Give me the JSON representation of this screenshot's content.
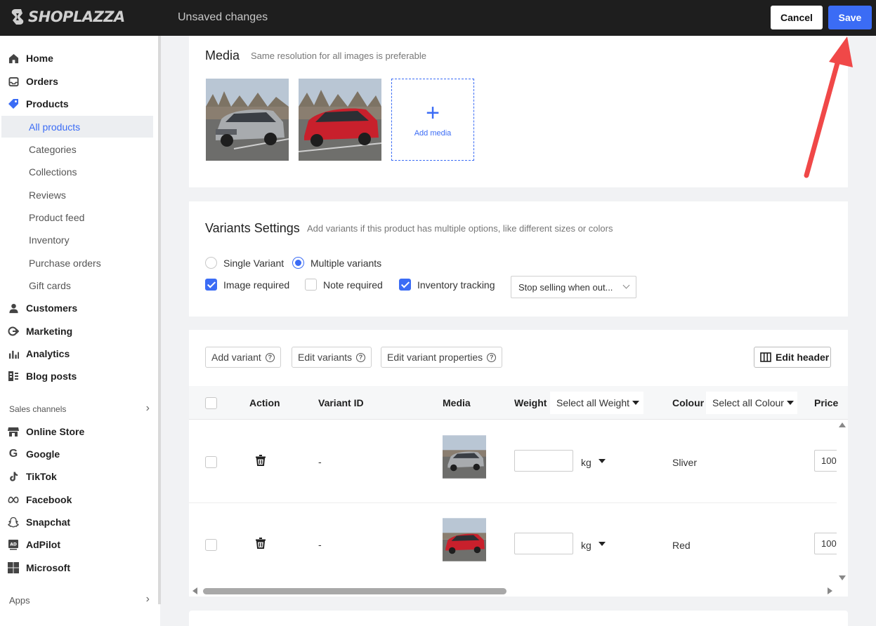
{
  "app": {
    "logo_text": "SHOPLAZZA",
    "status": "Unsaved changes"
  },
  "topbar": {
    "cancel_label": "Cancel",
    "save_label": "Save"
  },
  "sidebar": {
    "items": [
      {
        "label": "Home",
        "icon": "home-icon"
      },
      {
        "label": "Orders",
        "icon": "inbox-icon"
      },
      {
        "label": "Products",
        "icon": "tag-icon"
      }
    ],
    "products_sub": [
      "All products",
      "Categories",
      "Collections",
      "Reviews",
      "Product feed",
      "Inventory",
      "Purchase orders",
      "Gift cards"
    ],
    "items2": [
      {
        "label": "Customers",
        "icon": "person-icon"
      },
      {
        "label": "Marketing",
        "icon": "megaphone-icon"
      },
      {
        "label": "Analytics",
        "icon": "bar-chart-icon"
      },
      {
        "label": "Blog posts",
        "icon": "blog-icon"
      }
    ],
    "sales_channels_label": "Sales channels",
    "channels": [
      {
        "label": "Online Store",
        "icon": "store-icon"
      },
      {
        "label": "Google",
        "icon": "google-icon"
      },
      {
        "label": "TikTok",
        "icon": "tiktok-icon"
      },
      {
        "label": "Facebook",
        "icon": "meta-icon"
      },
      {
        "label": "Snapchat",
        "icon": "snapchat-icon"
      },
      {
        "label": "AdPilot",
        "icon": "adpilot-icon"
      },
      {
        "label": "Microsoft",
        "icon": "microsoft-icon"
      }
    ],
    "apps_label": "Apps"
  },
  "media": {
    "title": "Media",
    "subtitle": "Same resolution for all images is preferable",
    "add_label": "Add media"
  },
  "variants_settings": {
    "title": "Variants Settings",
    "subtitle": "Add variants if this product has multiple options, like different sizes or colors",
    "single_label": "Single Variant",
    "multiple_label": "Multiple variants",
    "image_required_label": "Image required",
    "note_required_label": "Note required",
    "inventory_tracking_label": "Inventory tracking",
    "oos_policy_value": "Stop selling when out..."
  },
  "variants_table": {
    "toolbar": {
      "add_variant": "Add variant",
      "edit_variants": "Edit variants",
      "edit_properties": "Edit variant properties",
      "edit_header": "Edit header"
    },
    "headers": {
      "action": "Action",
      "variant_id": "Variant ID",
      "media": "Media",
      "weight": "Weight",
      "weight_select": "Select all Weight",
      "colour": "Colour",
      "colour_select": "Select all Colour",
      "price": "Price(US"
    },
    "rows": [
      {
        "variant_id": "-",
        "unit": "kg",
        "colour": "Sliver",
        "price": "100"
      },
      {
        "variant_id": "-",
        "unit": "kg",
        "colour": "Red",
        "price": "100"
      }
    ]
  },
  "colors": {
    "accent": "#3b6cf5",
    "topbar": "#1e1e1e",
    "annotation_arrow": "#f04848"
  }
}
